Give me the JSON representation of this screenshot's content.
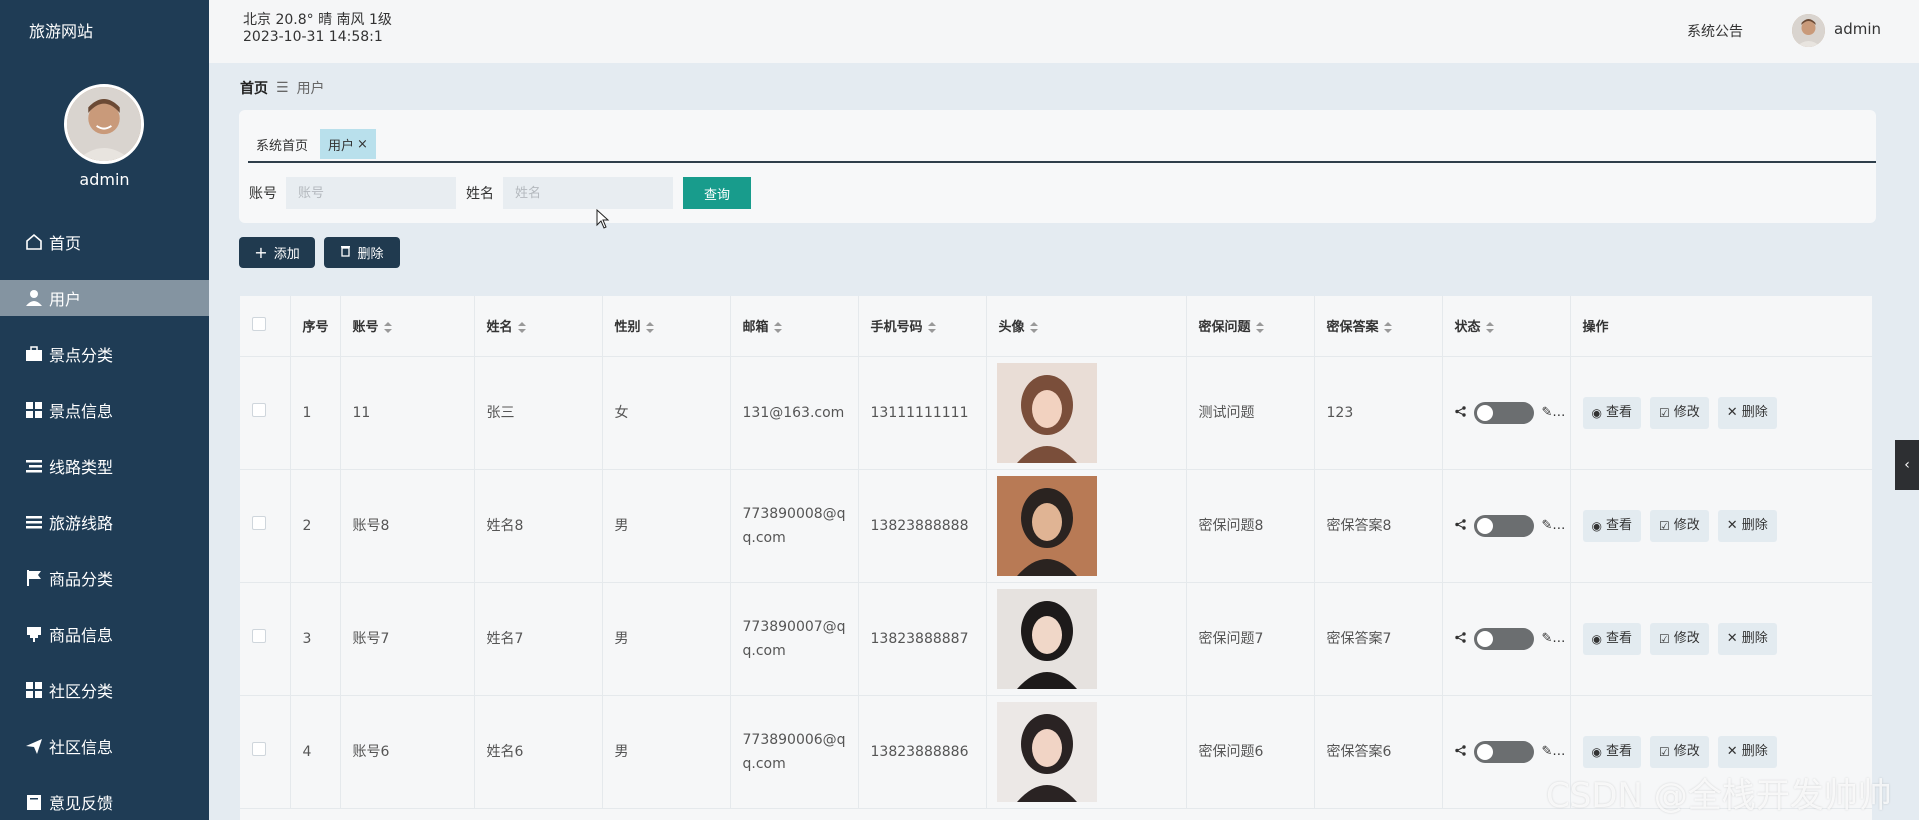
{
  "app": {
    "brand": "旅游网站"
  },
  "profile": {
    "name": "admin"
  },
  "sidebar": {
    "items": [
      {
        "label": "首页",
        "icon": "home-icon"
      },
      {
        "label": "用户",
        "icon": "user-icon",
        "active": true
      },
      {
        "label": "景点分类",
        "icon": "briefcase-icon"
      },
      {
        "label": "景点信息",
        "icon": "grid-icon"
      },
      {
        "label": "线路类型",
        "icon": "list-icon"
      },
      {
        "label": "旅游线路",
        "icon": "lines-icon"
      },
      {
        "label": "商品分类",
        "icon": "flag-icon"
      },
      {
        "label": "商品信息",
        "icon": "pin-icon"
      },
      {
        "label": "社区分类",
        "icon": "grid-icon"
      },
      {
        "label": "社区信息",
        "icon": "send-icon"
      },
      {
        "label": "意见反馈",
        "icon": "book-icon"
      }
    ]
  },
  "header": {
    "weather": "北京  20.8°  晴  南风  1级",
    "datetime": "2023-10-31 14:58:1",
    "notice": "系统公告",
    "user": "admin"
  },
  "breadcrumb": {
    "home": "首页",
    "current": "用户"
  },
  "tabs": [
    {
      "label": "系统首页"
    },
    {
      "label": "用户",
      "active": true
    }
  ],
  "search": {
    "account_label": "账号",
    "account_placeholder": "账号",
    "name_label": "姓名",
    "name_placeholder": "姓名",
    "button": "查询"
  },
  "actions": {
    "add": "添加",
    "delete": "删除"
  },
  "table": {
    "columns": [
      "序号",
      "账号",
      "姓名",
      "性别",
      "邮箱",
      "手机号码",
      "头像",
      "密保问题",
      "密保答案",
      "状态",
      "操作"
    ],
    "rows": [
      {
        "index": "1",
        "account": "11",
        "name": "张三",
        "gender": "女",
        "email": "131@163.com",
        "phone": "13111111111",
        "question": "测试问题",
        "answer": "123"
      },
      {
        "index": "2",
        "account": "账号8",
        "name": "姓名8",
        "gender": "男",
        "email": "773890008@qq.com",
        "phone": "13823888888",
        "question": "密保问题8",
        "answer": "密保答案8"
      },
      {
        "index": "3",
        "account": "账号7",
        "name": "姓名7",
        "gender": "男",
        "email": "773890007@qq.com",
        "phone": "13823888887",
        "question": "密保问题7",
        "answer": "密保答案7"
      },
      {
        "index": "4",
        "account": "账号6",
        "name": "姓名6",
        "gender": "男",
        "email": "773890006@qq.com",
        "phone": "13823888886",
        "question": "密保问题6",
        "answer": "密保答案6"
      }
    ],
    "ops": {
      "view": "查看",
      "edit": "修改",
      "delete": "删除"
    }
  },
  "watermark": "CSDN @全栈开发帅帅",
  "colors": {
    "sidebar": "#1f3c55",
    "accent": "#189c8c",
    "active_tab": "#b9e0ec"
  }
}
